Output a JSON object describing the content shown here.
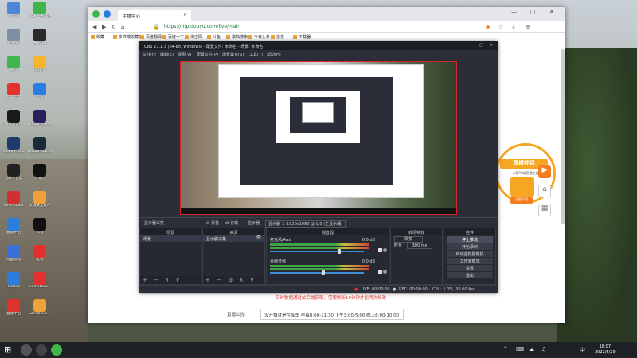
{
  "desktop": {
    "icons": [
      {
        "label": "此电脑",
        "color": "#4d86d6"
      },
      {
        "label": "Flow\n应用软件",
        "color": "#3fb54b"
      },
      {
        "label": "回收站",
        "color": "#7d8fa3"
      },
      {
        "label": "腾讯QQ",
        "color": "#2a2a2a"
      },
      {
        "label": "微信",
        "color": "#3fb54b"
      },
      {
        "label": "QQ音乐",
        "color": "#f7b52c"
      },
      {
        "label": "哔哩哔哩",
        "color": "#e2322d"
      },
      {
        "label": "迅雷",
        "color": "#2b7de0"
      },
      {
        "label": "网易云音乐",
        "color": "#1a1a1a"
      },
      {
        "label": "Adobe Premiere",
        "color": "#2a1f5a"
      },
      {
        "label": "Adobe Photoshop",
        "color": "#1c3a6b"
      },
      {
        "label": "Adobe Audition",
        "color": "#1a2a3a"
      },
      {
        "label": "剪映专业版",
        "color": "#222"
      },
      {
        "label": "YY语音",
        "color": "#111"
      },
      {
        "label": "WPS Office",
        "color": "#d32f2f"
      },
      {
        "label": "火绒安全软件",
        "color": "#f0a23a"
      },
      {
        "label": "直播伴侣",
        "color": "#2b7de0"
      },
      {
        "label": "抖音",
        "color": "#111"
      },
      {
        "label": "阿里云盘",
        "color": "#3b6fd8"
      },
      {
        "label": "酷我",
        "color": "#e2322d"
      },
      {
        "label": "ToDesk",
        "color": "#2b7de0"
      },
      {
        "label": "GameDow...",
        "color": "#e2322d"
      },
      {
        "label": "直播伴侣",
        "color": "#e2322d"
      },
      {
        "label": "Sandboxie...",
        "color": "#f0a23a"
      }
    ]
  },
  "browser": {
    "tab_title": "主播中心",
    "tab_close": "×",
    "new_tab": "+",
    "window_buttons": [
      "—",
      "□",
      "✕"
    ],
    "url": "https://mp.douyu.com/live/main",
    "bookmarks": [
      "收藏",
      "多终端收藏夹",
      "百度翻译",
      "百度一下",
      "淘宝网",
      "斗鱼",
      "歌曲搜索",
      "今日头条",
      "京东",
      "下载器"
    ],
    "promo": {
      "title": "直播伴侣",
      "subtitle": "斗鱼PC端直播工具",
      "button": "立即下载"
    },
    "notice": "实时数据通过前后端获取，需要刷新10分钟才能两次修改",
    "hours_label": "直播公告:",
    "hours_value": "没开播就是在练车 早晨8:00-11:30 下午3:00-5:00 晚上8:00-10:00",
    "scrollbar_color": "#cccccc"
  },
  "obs": {
    "title": "OBS 27.1.3 (64-bit, windows) - 配置文件: 未命名 - 场景: 未命名",
    "menu": [
      "文件(F)",
      "编辑(E)",
      "视图(V)",
      "配置文件(P)",
      "场景集合(S)",
      "工具(T)",
      "帮助(H)"
    ],
    "status_strip": [
      "显示器采集",
      "⚙ 属性",
      "⚙ 滤镜",
      "显示器",
      "显示器 1: 1920x1080 @ 0,0 (主显示器)"
    ],
    "scenes": {
      "title": "场景",
      "items": [
        "场景"
      ],
      "tools": "+ − ∧ ∨"
    },
    "sources": {
      "title": "来源",
      "items": [
        "显示器采集"
      ],
      "tools": "+ − ⚙ ∧ ∨"
    },
    "mixer": {
      "title": "混音器",
      "channels": [
        {
          "name": "麦克风/Aux",
          "db": "0.0 dB",
          "level": 0.72
        },
        {
          "name": "桌面音频",
          "db": "0.0 dB",
          "level": 0.55
        }
      ]
    },
    "transitions": {
      "title": "转场特效",
      "type": "渐变",
      "duration_label": "时长",
      "duration": "300 ms"
    },
    "controls": {
      "title": "控件",
      "buttons": [
        "停止推流",
        "开始录制",
        "启动虚拟摄像机",
        "工作室模式",
        "设置",
        "退出"
      ],
      "active": "停止推流"
    },
    "statusbar": {
      "live": "LIVE: 00:00:00",
      "rec": "REC: 00:00:00",
      "cpu": "CPU: 1.0%, 30.00 fps"
    }
  },
  "taskbar": {
    "apps": [
      {
        "name": "search",
        "color": "#555"
      },
      {
        "name": "obs",
        "color": "#444"
      },
      {
        "name": "browser",
        "color": "#3fb54b"
      }
    ],
    "time": "18:07",
    "date": "2022/5/29",
    "tray": [
      "^",
      "⌨",
      "☁",
      "♫",
      "中"
    ]
  }
}
